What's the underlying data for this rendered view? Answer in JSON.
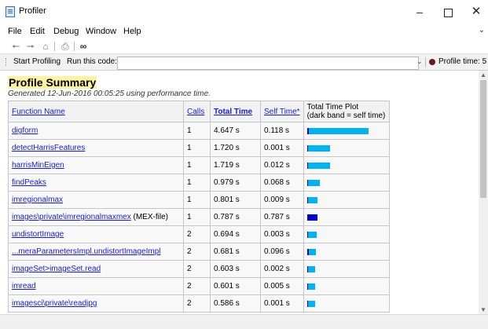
{
  "window": {
    "title": "Profiler"
  },
  "menu": {
    "items": [
      "File",
      "Edit",
      "Debug",
      "Window",
      "Help"
    ]
  },
  "toolbar": {
    "icons": [
      "back-arrow",
      "forward-arrow",
      "home",
      "print",
      "find"
    ]
  },
  "profbar": {
    "start_label": "Start Profiling",
    "run_label": "Run this code:",
    "code_value": "",
    "time_label": "Profile time: 5"
  },
  "summary": {
    "title": "Profile Summary",
    "generated": "Generated 12-Jun-2016 00:05:25 using performance time."
  },
  "table": {
    "headers": {
      "name": "Function Name",
      "calls": "Calls",
      "total": "Total Time",
      "self": "Self Time*",
      "plot_line1": "Total Time Plot",
      "plot_line2": "(dark band = self time)"
    },
    "rows": [
      {
        "name": "digform",
        "suffix": "",
        "calls": "1",
        "total": "4.647 s",
        "self": "0.118 s",
        "total_val": 4.647,
        "self_val": 0.118
      },
      {
        "name": "detectHarrisFeatures",
        "suffix": "",
        "calls": "1",
        "total": "1.720 s",
        "self": "0.001 s",
        "total_val": 1.72,
        "self_val": 0.001
      },
      {
        "name": "harrisMinEigen",
        "suffix": "",
        "calls": "1",
        "total": "1.719 s",
        "self": "0.012 s",
        "total_val": 1.719,
        "self_val": 0.012
      },
      {
        "name": "findPeaks",
        "suffix": "",
        "calls": "1",
        "total": "0.979 s",
        "self": "0.068 s",
        "total_val": 0.979,
        "self_val": 0.068
      },
      {
        "name": "imregionalmax",
        "suffix": "",
        "calls": "1",
        "total": "0.801 s",
        "self": "0.009 s",
        "total_val": 0.801,
        "self_val": 0.009
      },
      {
        "name": "images\\private\\imregionalmaxmex",
        "suffix": " (MEX-file)",
        "calls": "1",
        "total": "0.787 s",
        "self": "0.787 s",
        "total_val": 0.787,
        "self_val": 0.787
      },
      {
        "name": "undistortImage",
        "suffix": "",
        "calls": "2",
        "total": "0.694 s",
        "self": "0.003 s",
        "total_val": 0.694,
        "self_val": 0.003
      },
      {
        "name": "...meraParametersImpl.undistortImageImpl",
        "suffix": "",
        "calls": "2",
        "total": "0.681 s",
        "self": "0.096 s",
        "total_val": 0.681,
        "self_val": 0.096
      },
      {
        "name": "imageSet>imageSet.read",
        "suffix": "",
        "calls": "2",
        "total": "0.603 s",
        "self": "0.002 s",
        "total_val": 0.603,
        "self_val": 0.002
      },
      {
        "name": "imread",
        "suffix": "",
        "calls": "2",
        "total": "0.601 s",
        "self": "0.005 s",
        "total_val": 0.601,
        "self_val": 0.005
      },
      {
        "name": "imagesci\\private\\readjpg",
        "suffix": "",
        "calls": "2",
        "total": "0.586 s",
        "self": "0.001 s",
        "total_val": 0.586,
        "self_val": 0.001
      }
    ],
    "plot_max": 4.647
  },
  "colors": {
    "total_bar": "#00b3f0",
    "self_bar": "#0000cc",
    "title_highlight": "#fff2a0",
    "link": "#1a1ad4"
  }
}
